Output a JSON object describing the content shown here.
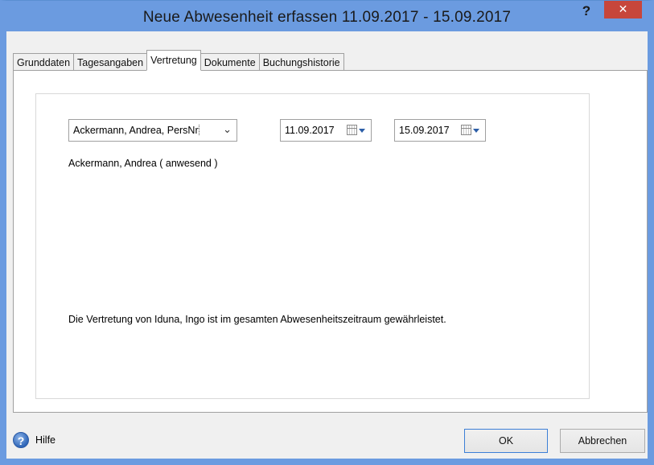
{
  "window": {
    "title": "Neue Abwesenheit erfassen 11.09.2017 - 15.09.2017",
    "help_label": "?",
    "close_label": "✕"
  },
  "tabs": [
    {
      "label": "Grunddaten"
    },
    {
      "label": "Tagesangaben"
    },
    {
      "label": "Vertretung",
      "active": true
    },
    {
      "label": "Dokumente"
    },
    {
      "label": "Buchungshistorie"
    }
  ],
  "vertretung": {
    "person_selected": "Ackermann, Andrea, PersNr",
    "date_from": "11.09.2017",
    "date_to": "15.09.2017",
    "status_text": "Ackermann, Andrea ( anwesend )",
    "info_text": "Die Vertretung von Iduna, Ingo ist im gesamten Abwesenheitszeitraum gewährleistet."
  },
  "footer": {
    "help_label": "Hilfe",
    "ok_label": "OK",
    "cancel_label": "Abbrechen"
  },
  "colors": {
    "titlebar": "#6b9be0",
    "close_button": "#c7463b",
    "accent": "#2b5ea7"
  },
  "icons": {
    "close": "close-icon",
    "help": "help-icon",
    "calendar": "calendar-icon",
    "dropdown": "chevron-down-icon"
  }
}
